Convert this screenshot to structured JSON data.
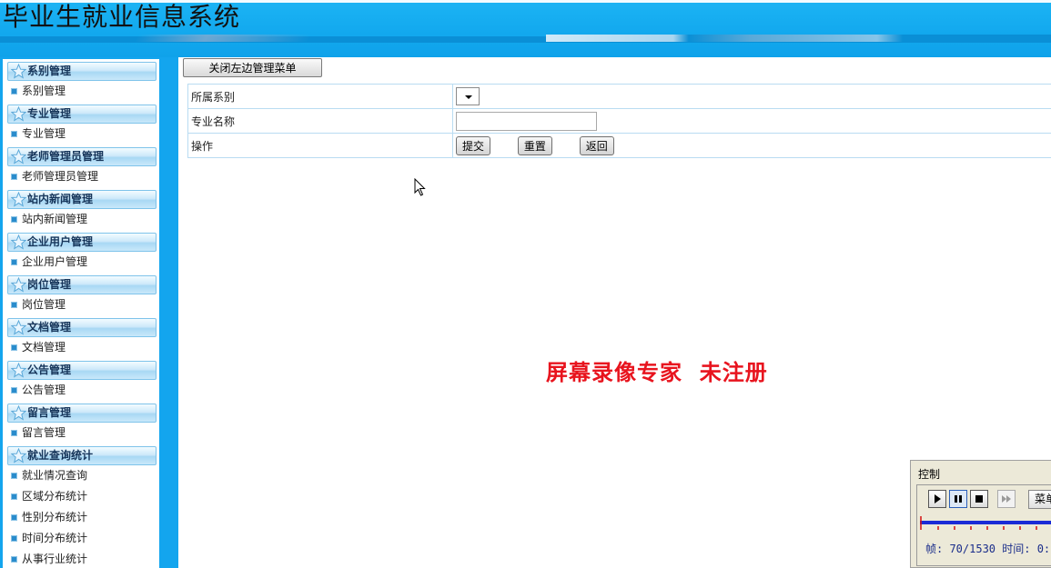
{
  "header": {
    "title": "毕业生就业信息系统"
  },
  "sidebar": {
    "sections": [
      {
        "title": "系别管理",
        "items": [
          "系别管理"
        ]
      },
      {
        "title": "专业管理",
        "items": [
          "专业管理"
        ]
      },
      {
        "title": "老师管理员管理",
        "items": [
          "老师管理员管理"
        ]
      },
      {
        "title": "站内新闻管理",
        "items": [
          "站内新闻管理"
        ]
      },
      {
        "title": "企业用户管理",
        "items": [
          "企业用户管理"
        ]
      },
      {
        "title": "岗位管理",
        "items": [
          "岗位管理"
        ]
      },
      {
        "title": "文档管理",
        "items": [
          "文档管理"
        ]
      },
      {
        "title": "公告管理",
        "items": [
          "公告管理"
        ]
      },
      {
        "title": "留言管理",
        "items": [
          "留言管理"
        ]
      },
      {
        "title": "就业查询统计",
        "items": [
          "就业情况查询",
          "区域分布统计",
          "性别分布统计",
          "时间分布统计",
          "从事行业统计"
        ]
      }
    ]
  },
  "toolbar": {
    "toggle_label": "关闭左边管理菜单"
  },
  "form": {
    "department_label": "所属系别",
    "department_value": "",
    "major_label": "专业名称",
    "major_value": "",
    "action_label": "操作",
    "submit_label": "提交",
    "reset_label": "重置",
    "back_label": "返回"
  },
  "watermark": {
    "text": "屏幕录像专家  未注册"
  },
  "recorder": {
    "title": "控制",
    "menu_label": "菜单",
    "status_text": "帧: 70/1530 时间: 0:"
  },
  "colors": {
    "header_blue": "#12a8ee",
    "sidebar_blue": "#13a5ee",
    "watermark_red": "#e8141e",
    "table_border": "#b9dcf2"
  },
  "icons": [
    "star-icon",
    "menu-bullet-icon",
    "dropdown-arrow-icon",
    "mouse-cursor-icon",
    "play-icon",
    "pause-icon",
    "stop-icon",
    "skip-icon"
  ]
}
